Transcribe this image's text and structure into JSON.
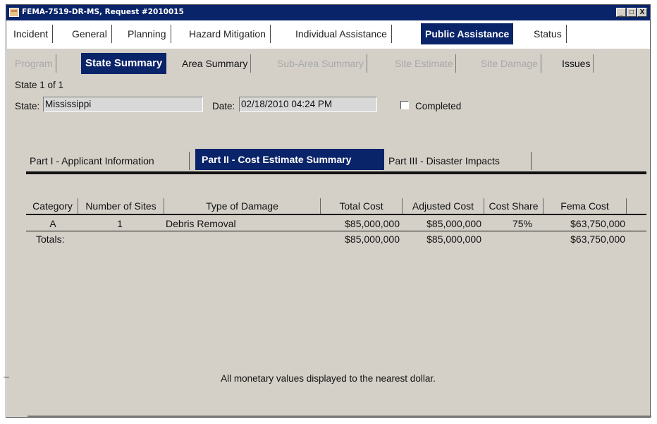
{
  "window": {
    "title": "FEMA-7519-DR-MS, Request #2010015",
    "min_label": "_",
    "max_label": "□",
    "close_label": "X"
  },
  "main_tabs": [
    {
      "label": "Incident"
    },
    {
      "label": "General"
    },
    {
      "label": "Planning"
    },
    {
      "label": "Hazard Mitigation"
    },
    {
      "label": "Individual Assistance"
    },
    {
      "label": "Public Assistance",
      "active": true
    },
    {
      "label": "Status"
    }
  ],
  "sub_tabs": [
    {
      "label": "Program",
      "disabled": true
    },
    {
      "label": "State Summary",
      "active": true
    },
    {
      "label": "Area Summary"
    },
    {
      "label": "Sub-Area Summary",
      "disabled": true
    },
    {
      "label": "Site Estimate",
      "disabled": true
    },
    {
      "label": "Site Damage",
      "disabled": true
    },
    {
      "label": "Issues"
    }
  ],
  "state_info": {
    "counter": "State 1 of 1",
    "state_label": "State:",
    "state_value": "Mississippi",
    "date_label": "Date:",
    "date_value": "02/18/2010 04:24 PM",
    "completed_label": "Completed"
  },
  "part_tabs": [
    {
      "label": "Part I - Applicant Information"
    },
    {
      "label": "Part II - Cost Estimate Summary",
      "active": true
    },
    {
      "label": "Part III - Disaster Impacts"
    }
  ],
  "table": {
    "columns": [
      "Category",
      "Number of Sites",
      "Type of Damage",
      "Total Cost",
      "Adjusted Cost",
      "Cost Share",
      "Fema Cost"
    ],
    "rows": [
      {
        "category": "A",
        "sites": "1",
        "type": "Debris Removal",
        "total": "$85,000,000",
        "adjusted": "$85,000,000",
        "share": "75%",
        "fema": "$63,750,000"
      }
    ],
    "totals": {
      "label": "Totals:",
      "total": "$85,000,000",
      "adjusted": "$85,000,000",
      "fema": "$63,750,000"
    }
  },
  "footnote": "All monetary values displayed to the nearest dollar."
}
